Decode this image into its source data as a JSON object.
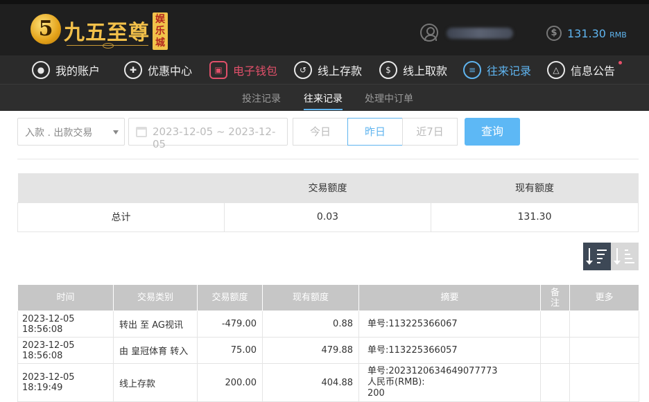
{
  "header": {
    "logo_digit": "5",
    "logo_text": "九五至尊",
    "logo_tag": [
      "娱",
      "乐",
      "城"
    ],
    "balance": "131.30",
    "balance_unit": "RMB",
    "balance_icon": "dollar-icon"
  },
  "nav": [
    {
      "label": "我的账户",
      "icon": "user-icon",
      "glyph": "◯"
    },
    {
      "label": "优惠中心",
      "icon": "gift-icon",
      "glyph": "✚"
    },
    {
      "label": "电子钱包",
      "icon": "wallet-icon",
      "glyph": "▣"
    },
    {
      "label": "线上存款",
      "icon": "deposit-icon",
      "glyph": "↺"
    },
    {
      "label": "线上取款",
      "icon": "withdraw-icon",
      "glyph": "$"
    },
    {
      "label": "往来记录",
      "icon": "record-icon",
      "glyph": "≡"
    },
    {
      "label": "信息公告",
      "icon": "bell-icon",
      "glyph": "△"
    }
  ],
  "subtabs": [
    "投注记录",
    "往来记录",
    "处理中订单"
  ],
  "filter": {
    "type_value": "入款 . 出款交易",
    "date_range": "2023-12-05 ~ 2023-12-05",
    "quick": [
      "今日",
      "昨日",
      "近7日"
    ],
    "search_label": "查询"
  },
  "summary": {
    "headers": [
      "",
      "交易额度",
      "现有额度"
    ],
    "row": [
      "总计",
      "0.03",
      "131.30"
    ]
  },
  "records": {
    "headers": [
      "时间",
      "交易类别",
      "交易额度",
      "现有额度",
      "摘要",
      "备\n注",
      "更多"
    ],
    "rows": [
      {
        "time": "2023-12-05 18:56:08",
        "type": "转出 至 AG视讯",
        "amount": "-479.00",
        "balance": "0.88",
        "summary": [
          "单号:113225366067"
        ]
      },
      {
        "time": "2023-12-05 18:56:08",
        "type": "由 皇冠体育 转入",
        "amount": "75.00",
        "balance": "479.88",
        "summary": [
          "单号:113225366057"
        ]
      },
      {
        "time": "2023-12-05 18:19:49",
        "type": "线上存款",
        "amount": "200.00",
        "balance": "404.88",
        "summary": [
          "单号:2023120634649077773",
          "人民币(RMB):",
          "200"
        ]
      }
    ]
  },
  "colors": {
    "accent": "#5fb4ef",
    "wallet": "#e0506a",
    "header_bg": "#1f1f1f"
  }
}
